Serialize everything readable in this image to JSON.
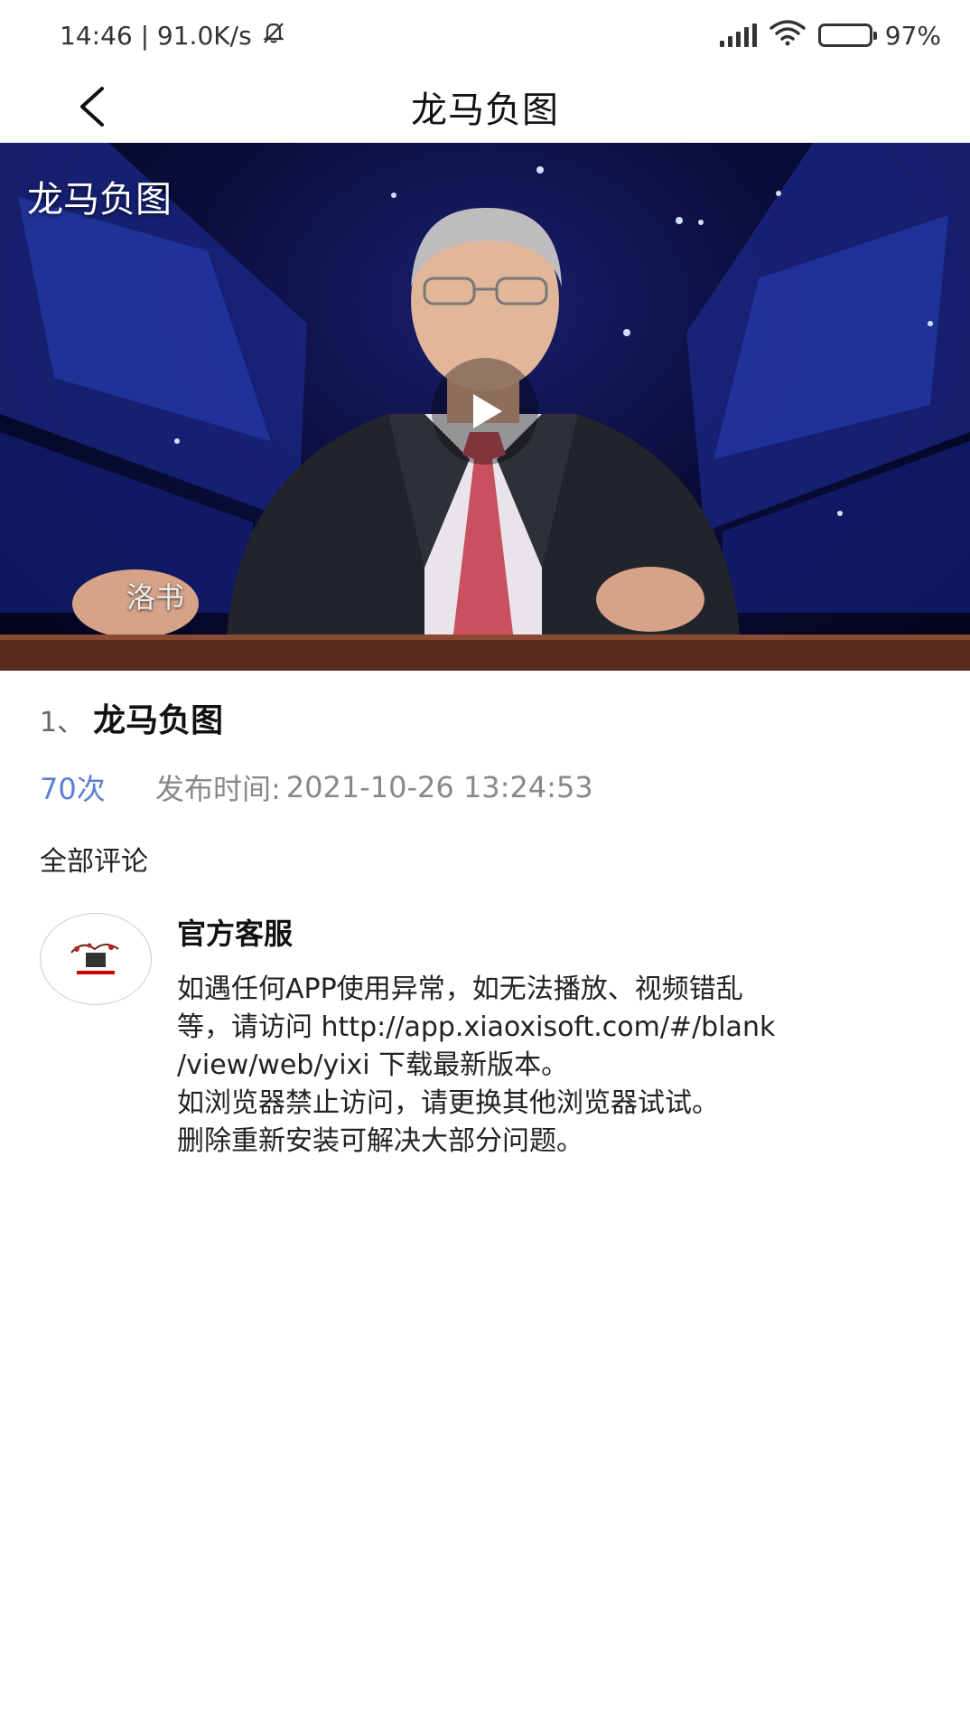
{
  "status_bar": {
    "time_speed": "14:46 | 91.0K/s",
    "battery": "97%",
    "icons": [
      "mute-bell-icon",
      "signal-icon",
      "wifi-icon",
      "battery-icon"
    ]
  },
  "nav": {
    "back_icon": "chevron-left-icon",
    "title": "龙马负图"
  },
  "video": {
    "overlay_title": "龙马负图",
    "caption": "洛书",
    "play_icon": "play-icon"
  },
  "info": {
    "index": "1、",
    "title": "龙马负图",
    "views": "70次",
    "publish_label": "发布时间:",
    "publish_time": "2021-10-26 13:24:53"
  },
  "comments": {
    "heading": "全部评论",
    "items": [
      {
        "author": "官方客服",
        "lines": [
          "如遇任何APP使用异常，如无法播放、视频错乱",
          "等，请访问 http://app.xiaoxisoft.com/#/blank",
          "/view/web/yixi 下载最新版本。",
          "如浏览器禁止访问，请更换其他浏览器试试。",
          "删除重新安装可解决大部分问题。"
        ]
      }
    ]
  },
  "colors": {
    "accent": "#5b7fd6",
    "muted": "#888888",
    "video_bg": "#0a0d3a"
  }
}
